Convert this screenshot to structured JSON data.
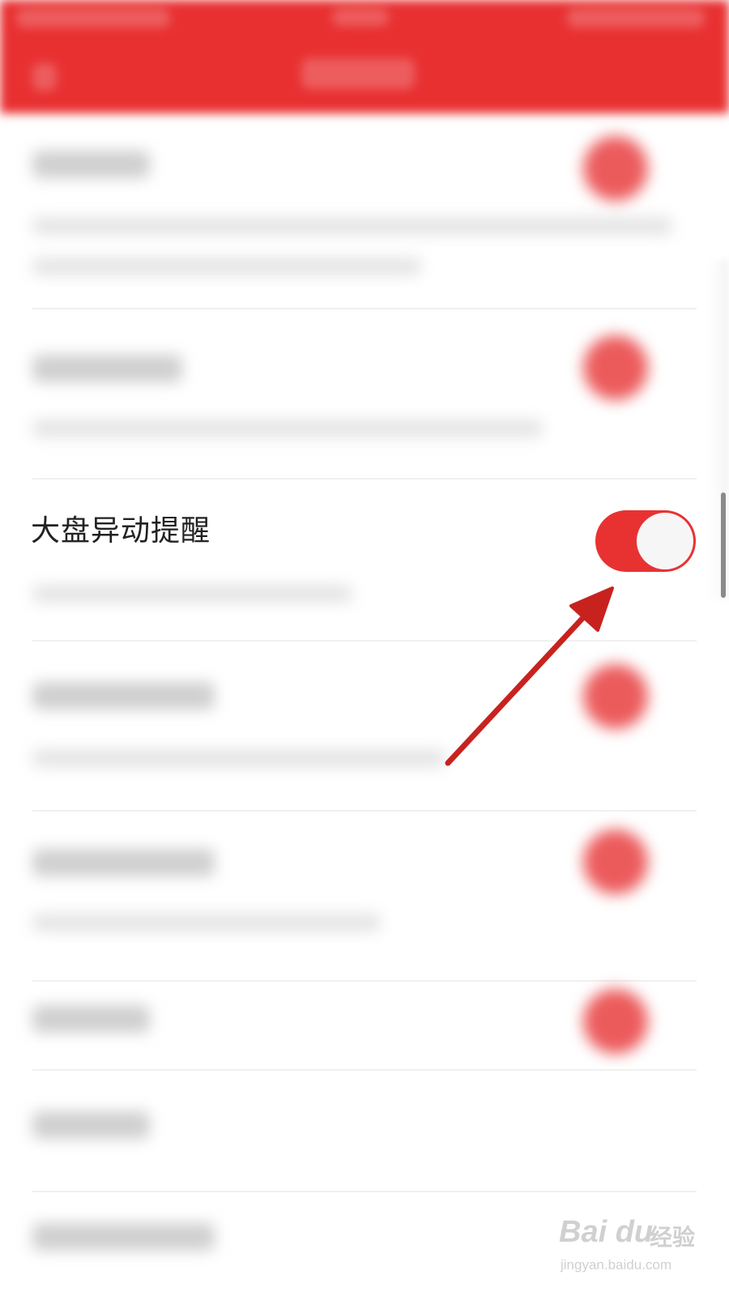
{
  "settings": {
    "focused_item": {
      "title": "大盘异动提醒",
      "toggle_on": true
    }
  },
  "colors": {
    "header": "#e83031",
    "toggle_on": "#e83232",
    "arrow": "#c8221f"
  },
  "watermark": {
    "brand": "Bai du",
    "name": "经验",
    "url": "jingyan.baidu.com"
  }
}
